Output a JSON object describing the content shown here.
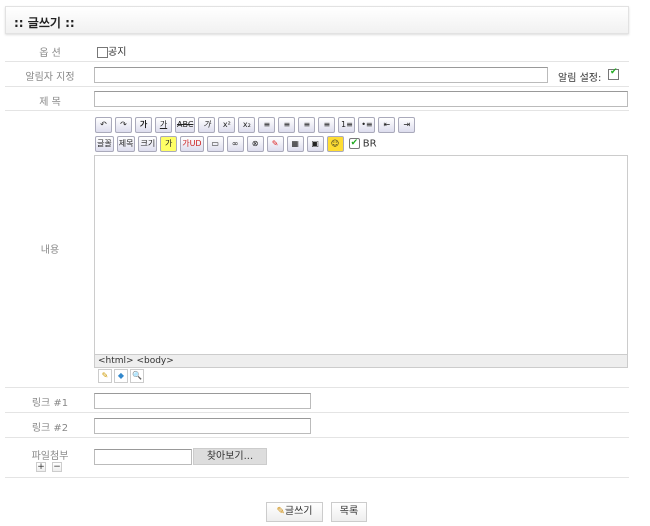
{
  "header": {
    "title": ":: 글쓰기 ::"
  },
  "options": {
    "label": "옵 션",
    "notice_label": "공지"
  },
  "notify": {
    "label": "알림자 지정",
    "setting_label": "알림 설정:",
    "setting_checked": true
  },
  "subject": {
    "label": "제 목",
    "value": ""
  },
  "content": {
    "label": "내용",
    "toolbar_row1": [
      "↶",
      "↷",
      "가",
      "가",
      "ABC",
      "가",
      "x²",
      "x₂",
      "≡",
      "≡",
      "≡",
      "≡",
      "1≡",
      "•≡",
      "⇤",
      "⇥"
    ],
    "toolbar_row2": [
      "글꼴",
      "제목",
      "크기",
      "가",
      "가UD",
      "▭",
      "∞",
      "⊗",
      "✎",
      "▦",
      "▣",
      "☺"
    ],
    "br_label": "BR",
    "br_checked": true,
    "status_path": "<html> <body>",
    "modes": [
      "✎",
      "◆",
      "🔍"
    ]
  },
  "link1": {
    "label": "링크 #1",
    "value": ""
  },
  "link2": {
    "label": "링크 #2",
    "value": ""
  },
  "file": {
    "label": "파일첨부",
    "browse_label": "찾아보기...",
    "add": "+",
    "remove": "−"
  },
  "actions": {
    "submit_label": "글쓰기",
    "list_label": "목록"
  }
}
